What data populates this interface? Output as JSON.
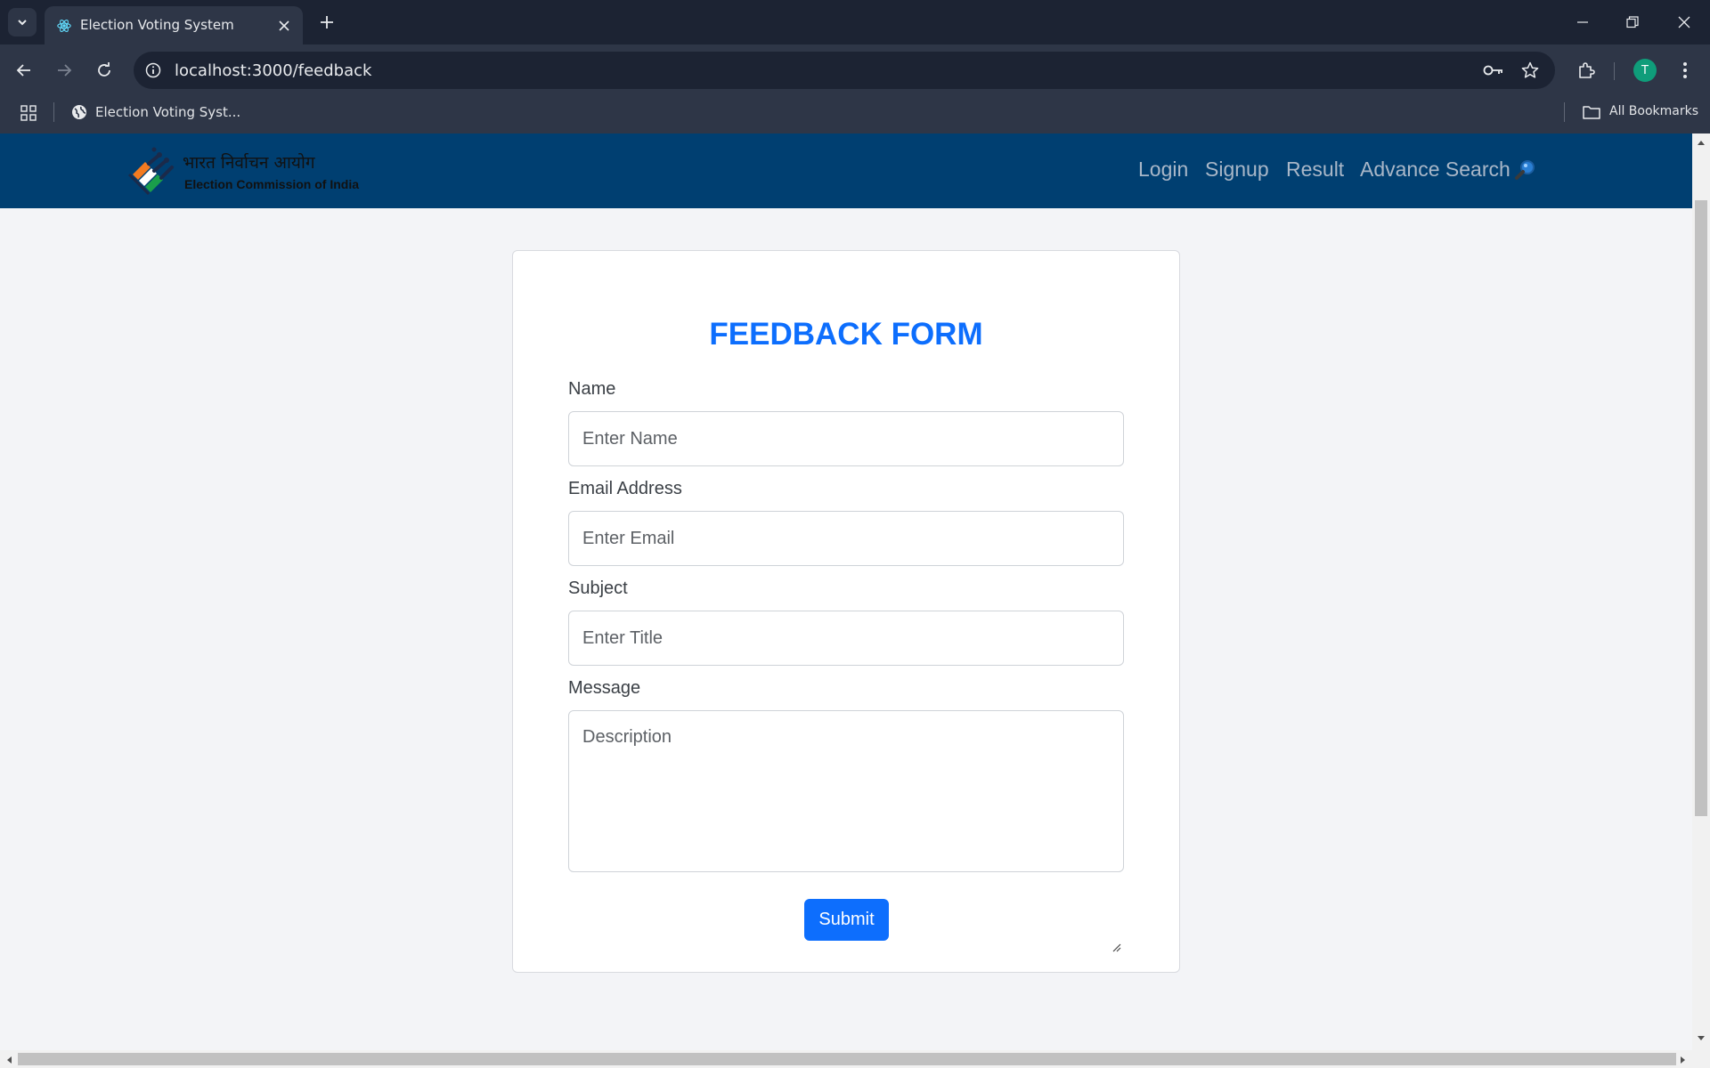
{
  "browser": {
    "tab_title": "Election Voting System",
    "url": "localhost:3000/feedback",
    "bookmark_label": "Election Voting Syst...",
    "all_bookmarks_label": "All Bookmarks",
    "profile_initial": "T"
  },
  "header": {
    "logo_hindi": "भारत निर्वाचन आयोग",
    "logo_english": "Election Commission of India",
    "nav": [
      "Login",
      "Signup",
      "Result",
      "Advance Search"
    ],
    "search_icon": "magnifier-icon"
  },
  "form": {
    "title": "FEEDBACK FORM",
    "name_label": "Name",
    "name_placeholder": "Enter Name",
    "email_label": "Email Address",
    "email_placeholder": "Enter Email",
    "subject_label": "Subject",
    "subject_placeholder": "Enter Title",
    "message_label": "Message",
    "message_placeholder": "Description",
    "submit_label": "Submit"
  },
  "colors": {
    "navbar": "#003f71",
    "accent": "#0d6efd"
  }
}
